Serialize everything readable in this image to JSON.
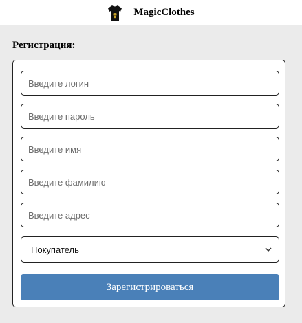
{
  "header": {
    "logo_icon": "tshirt-icon",
    "brand_name": "MagicClothes"
  },
  "registration": {
    "title": "Регистрация:",
    "fields": {
      "login": {
        "value": "",
        "placeholder": "Введите логин"
      },
      "password": {
        "value": "",
        "placeholder": "Введите пароль"
      },
      "first_name": {
        "value": "",
        "placeholder": "Введите имя"
      },
      "last_name": {
        "value": "",
        "placeholder": "Введите фамилию"
      },
      "address": {
        "value": "",
        "placeholder": "Введите адрес"
      }
    },
    "role_select": {
      "selected": "Покупатель",
      "icon": "chevron-down-icon"
    },
    "submit_label": "Зарегистрироваться"
  },
  "colors": {
    "page_background": "#ebebeb",
    "header_background": "#ffffff",
    "button_background": "#4a80b8",
    "button_text": "#ffffff",
    "border": "#222222"
  }
}
